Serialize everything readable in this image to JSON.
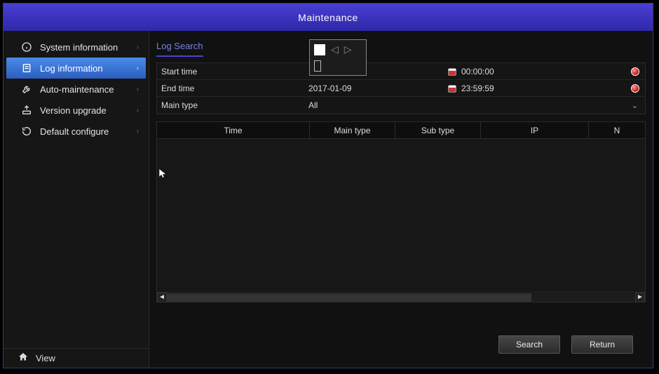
{
  "title": "Maintenance",
  "sidebar": {
    "items": [
      {
        "label": "System information"
      },
      {
        "label": "Log information"
      },
      {
        "label": "Auto-maintenance"
      },
      {
        "label": "Version upgrade"
      },
      {
        "label": "Default configure"
      }
    ],
    "bottom_label": "View"
  },
  "tabs": {
    "log_search": "Log Search"
  },
  "form": {
    "start_label": "Start time",
    "start_date": "",
    "start_time": "00:00:00",
    "end_label": "End time",
    "end_date": "2017-01-09",
    "end_time": "23:59:59",
    "main_type_label": "Main type",
    "main_type_value": "All"
  },
  "table": {
    "columns": {
      "time": "Time",
      "main_type": "Main type",
      "sub_type": "Sub type",
      "ip": "IP",
      "last": "N"
    }
  },
  "buttons": {
    "search": "Search",
    "return": "Return"
  }
}
